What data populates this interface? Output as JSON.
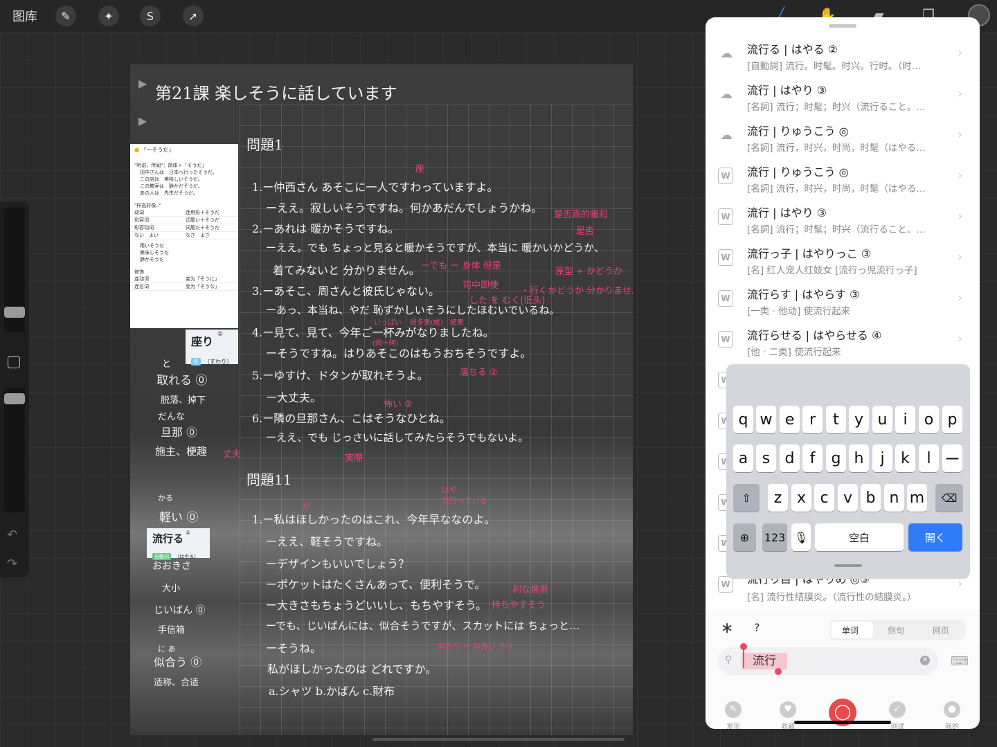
{
  "topbar": {
    "gallery": "图库",
    "tools": [
      "wrench-icon",
      "magic-wand-icon",
      "selection-icon",
      "transform-arrow-icon"
    ],
    "right_tools": [
      "brush-icon",
      "smudge-icon",
      "eraser-icon",
      "layers-icon"
    ]
  },
  "doc": {
    "lesson_title": "第21課 楽しそうに話しています",
    "section1": "問題1",
    "section2": "問題11",
    "lines1": [
      "1.ー仲西さん あそこに一人ですわっていますよ。",
      "ーええ。寂しいそうですね。何かあだんでしょうかね。",
      "2.ーあれは 暖かそうですね。",
      "ーええ。でも ちょっと見ると暖かそうですが、本当に 暖かいかどうか、",
      "着てみないと 分かりません。",
      "3.ーあそこ、周さんと彼氏じゃない。",
      "ーあっ、本当ね、やだ 恥ずかしいそうにしたほむいでいるね。",
      "4.ー見て、見て、今年ご一杯みがなりましたね。",
      "ーそうですね。はりあそこのはもうおちそうですよ。",
      "5.ーゆすけ、ドタンが取れそうよ。",
      "ー大丈夫。",
      "6.ー隣の旦那さん、こはそうなひとね。",
      "ーええ、でも じっさいに話してみたらそうでもないよ。"
    ],
    "lines2": [
      "1.ー私はほしかったのはこれ、今年早ななのよ。",
      "ーええ、軽そうですね。",
      "ーデザインもいいでしょう？",
      "ーポケットはたくさんあって、便利そうで。",
      "ー大きさもちょうどいいし、もちやすそう。",
      "ーでも、じいばんには、似合そうですが、スカットには ちょっと…",
      "ーそうね。",
      "私がほしかったのは どれですか。",
      "a.シャツ   b.かばん   c.財布"
    ],
    "pink_notes": [
      "座",
      "是否真的暖和",
      "是否",
      "ーでも ー 身体 但是",
      "司中即使",
      "した を むく(低头)",
      "・行くかどうか 分かりません。",
      "原型 + かどうか",
      "いっぱい",
      "很多果(成)",
      "結果",
      "(闹一阿)",
      "落ちる ②",
      "怖い ②",
      "実際",
      "が",
      "はや",
      "流行っている",
      "利な携帯",
      "持ちやすそう",
      "似合う ー 似合い そう"
    ],
    "margin_words": [
      "と",
      "取れる ⓪",
      "脱落、掉下",
      "だんな",
      "旦那 ⓪",
      "施主、梗趣",
      "丈夫",
      "かる",
      "軽い ⓪",
      "おおきさ",
      "大小",
      "じいばん ⓪",
      "手信箱",
      "に あ",
      "似合う ⓪",
      "适称、合适"
    ]
  },
  "note_card": {
    "title": "「～そうだ」",
    "b1": "\"听说，传闻\"：简体＋「そうだ」",
    "ex": [
      "田中さんは　日本へ行ったそうだ。",
      "この店は　美味しいそうだ。",
      "この教室は　静かだそうだ。",
      "あの人は　先生だそうだ。"
    ],
    "b2": "\"样态好像..\"",
    "table": [
      [
        "动词",
        "连用形＋そうだ"
      ],
      [
        "形容词",
        "词尾い＋そうだ"
      ],
      [
        "形容动词",
        "词尾だ＋そうだ"
      ],
      [
        "ない　よい",
        "なさ　よさ"
      ]
    ],
    "ex2": [
      "雨いそうだ",
      "美味しそうだ",
      "静かそうだ"
    ],
    "b3": "修饰",
    "table2": [
      [
        "连动词",
        "变为「そうに」"
      ],
      [
        "连名词",
        "变为「そうな」"
      ]
    ]
  },
  "word_cards": [
    {
      "word": "座り",
      "sup": "①",
      "pos": "名",
      "reading": "〔すわり〕"
    },
    {
      "word": "流行る",
      "sup": "②",
      "pos": "自動詞",
      "reading": "〔はやる〕"
    }
  ],
  "dictionary": {
    "entries": [
      {
        "icon": "cloud-icon",
        "head": "流行る | はやる ②",
        "def": "[自動詞] 流行。时髦。时兴。行时。（时…"
      },
      {
        "icon": "cloud-icon",
        "head": "流行 | はやり ③",
        "def": "[名詞] 流行；时髦；时兴（流行ること。…"
      },
      {
        "icon": "cloud-icon",
        "head": "流行 | りゅうこう ◎",
        "def": "[名詞] 流行，时兴，时尚，时髦（はやる…"
      },
      {
        "icon": "word-book-icon",
        "head": "流行 | りゅうこう ◎",
        "def": "[名詞] 流行，时兴，时尚，时髦（はやる…"
      },
      {
        "icon": "word-book-icon",
        "head": "流行 | はやり ③",
        "def": "[名詞] 流行；时髦；时兴（流行ること。…"
      },
      {
        "icon": "word-book-icon",
        "head": "流行っ子 | はやりっこ ③",
        "def": "[名] 红人宠人红妓女 [流行っ児流行っ子]"
      },
      {
        "icon": "word-book-icon",
        "head": "流行らす | はやらす ③",
        "def": "[一类 · 他动] 使流行起来"
      },
      {
        "icon": "word-book-icon",
        "head": "流行らせる | はやらせる ④",
        "def": "[他 · 二类] 使流行起来"
      }
    ],
    "last_entry": {
      "head": "流行り目 | はやりめ ◎③",
      "def": "[名] 流行性结膜炎。（流行性の結膜炎。）"
    },
    "segments": [
      "单词",
      "例句",
      "网页"
    ],
    "search_value": "流行",
    "nav": [
      "发现",
      "收藏",
      "",
      "测试",
      "我的"
    ]
  },
  "keyboard": {
    "row1": [
      "q",
      "w",
      "e",
      "r",
      "t",
      "y",
      "u",
      "i",
      "o",
      "p"
    ],
    "row2": [
      "a",
      "s",
      "d",
      "f",
      "g",
      "h",
      "j",
      "k",
      "l",
      "ー"
    ],
    "row3": [
      "z",
      "x",
      "c",
      "v",
      "b",
      "n",
      "m"
    ],
    "num": "123",
    "space": "空白",
    "go": "開く"
  }
}
